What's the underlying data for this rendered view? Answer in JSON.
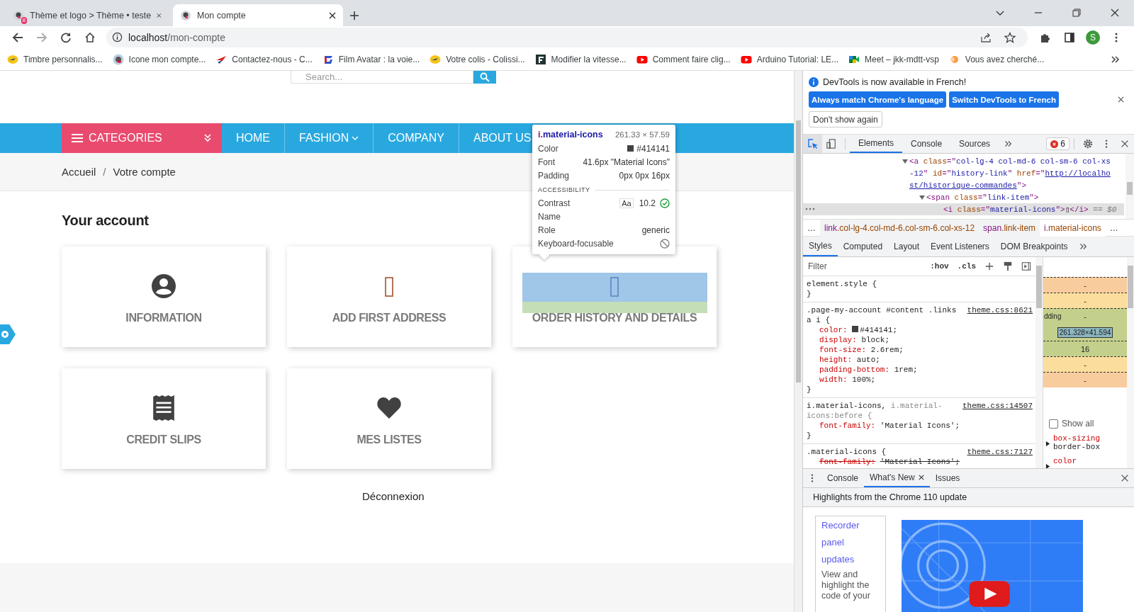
{
  "browser": {
    "tabs": [
      {
        "title": "Thème et logo > Thème • teste",
        "selected": false,
        "badge": "8"
      },
      {
        "title": "Mon compte",
        "selected": true
      }
    ],
    "address": {
      "host": "localhost",
      "path": "/mon-compte"
    },
    "profile_initial": "S",
    "bookmarks": [
      {
        "label": "Timbre personnalis...",
        "kind": "post"
      },
      {
        "label": "Icone mon compte...",
        "kind": "shop"
      },
      {
        "label": "Contactez-nous - C...",
        "kind": "plane"
      },
      {
        "label": "Film Avatar : la voie...",
        "kind": "g"
      },
      {
        "label": "Votre colis - Colissi...",
        "kind": "post"
      },
      {
        "label": "Modifier la vitesse...",
        "kind": "f"
      },
      {
        "label": "Comment faire clig...",
        "kind": "youtube"
      },
      {
        "label": "Arduino Tutorial: LE...",
        "kind": "youtube"
      },
      {
        "label": "Meet – jkk-mdtt-vsp",
        "kind": "meet"
      },
      {
        "label": "Vous avez cherché...",
        "kind": "dot"
      }
    ]
  },
  "page": {
    "search_placeholder": "Search...",
    "categories": "CATEGORIES",
    "nav": [
      {
        "label": "HOME",
        "dropdown": false
      },
      {
        "label": "FASHION",
        "dropdown": true
      },
      {
        "label": "COMPANY",
        "dropdown": false
      },
      {
        "label": "ABOUT US",
        "dropdown": false
      }
    ],
    "breadcrumb": {
      "items": [
        "Accueil",
        "Votre compte"
      ],
      "separator": "/"
    },
    "heading": "Your account",
    "cards": [
      {
        "label": "INFORMATION",
        "kind": "person",
        "highlighted": false
      },
      {
        "label": "ADD FIRST ADDRESS",
        "kind": "missing",
        "highlighted": false
      },
      {
        "label": "ORDER HISTORY AND DETAILS",
        "kind": "missing",
        "highlighted": true
      },
      {
        "label": "CREDIT SLIPS",
        "kind": "receipt",
        "highlighted": false
      },
      {
        "label": "MES LISTES",
        "kind": "heart",
        "highlighted": false
      }
    ],
    "logout": "Déconnexion"
  },
  "inspector_tooltip": {
    "selector": "i.material-icons",
    "size": "261.33 × 57.59",
    "rows": [
      {
        "label": "Color",
        "kind": "color",
        "value": "#414141"
      },
      {
        "label": "Font",
        "kind": "text",
        "value": "41.6px \"Material Icons\""
      },
      {
        "label": "Padding",
        "kind": "text",
        "value": "0px 0px 16px"
      }
    ],
    "accessibility": {
      "title": "ACCESSIBILITY",
      "rows": [
        {
          "label": "Contrast",
          "kind": "contrast",
          "sample": "Aa",
          "value": "10.2",
          "passes": true
        },
        {
          "label": "Name",
          "kind": "text"
        },
        {
          "label": "Role",
          "kind": "text",
          "value": "generic"
        },
        {
          "label": "Keyboard-focusable",
          "kind": "focusable",
          "focusable": false
        }
      ]
    }
  },
  "devtools": {
    "notice": {
      "text": "DevTools is now available in French!",
      "buttons": [
        "Always match Chrome's language",
        "Switch DevTools to French"
      ],
      "dismiss": "Don't show again"
    },
    "tabs": [
      {
        "label": "Elements",
        "selected": true
      },
      {
        "label": "Console",
        "selected": false
      },
      {
        "label": "Sources",
        "selected": false
      }
    ],
    "error_count": "6",
    "dom": {
      "expanded": true,
      "selected": false,
      "lines": [
        [
          {
            "text": "<a ",
            "kind": "tag"
          },
          {
            "text": "class",
            "kind": "attr"
          },
          {
            "text": "=\"",
            "kind": "tag"
          },
          {
            "text": "col-lg-4 col-md-6 col-sm-6 col-xs",
            "kind": "val"
          }
        ],
        [
          {
            "text": "-12",
            "kind": "val"
          },
          {
            "text": "\" ",
            "kind": "tag"
          },
          {
            "text": "id",
            "kind": "attr"
          },
          {
            "text": "=\"",
            "kind": "tag"
          },
          {
            "text": "history-link",
            "kind": "val"
          },
          {
            "text": "\" ",
            "kind": "tag"
          },
          {
            "text": "href",
            "kind": "attr"
          },
          {
            "text": "=\"",
            "kind": "tag"
          },
          {
            "text": "http://localho",
            "kind": "link"
          }
        ],
        [
          {
            "text": "st/historique-commandes",
            "kind": "link"
          },
          {
            "text": "\">",
            "kind": "tag"
          }
        ]
      ],
      "children": [
        {
          "expanded": true,
          "selected": false,
          "lines": [
            [
              {
                "text": "<span ",
                "kind": "tag"
              },
              {
                "text": "class",
                "kind": "attr"
              },
              {
                "text": "=\"",
                "kind": "tag"
              },
              {
                "text": "link-item",
                "kind": "val"
              },
              {
                "text": "\">",
                "kind": "tag"
              }
            ]
          ],
          "children": [
            {
              "selected": true,
              "lines": [
                [
                  {
                    "text": "<i ",
                    "kind": "tag"
                  },
                  {
                    "text": "class",
                    "kind": "attr"
                  },
                  {
                    "text": "=\"",
                    "kind": "tag"
                  },
                  {
                    "text": "material-icons",
                    "kind": "val"
                  },
                  {
                    "text": "\">",
                    "kind": "tag"
                  },
                  {
                    "text": "▯",
                    "kind": "text"
                  },
                  {
                    "text": "</i>",
                    "kind": "tag"
                  },
                  {
                    "text": " == $0",
                    "kind": "dim"
                  }
                ]
              ]
            }
          ]
        }
      ]
    },
    "crumbs": {
      "lead": "…",
      "trail": "…",
      "items": [
        {
          "tag": "link",
          "classes": ".col-lg-4.col-md-6.col-sm-6.col-xs-12",
          "selected": false
        },
        {
          "tag": "span",
          "classes": ".link-item",
          "selected": false
        },
        {
          "tag": "i",
          "classes": ".material-icons",
          "selected": true
        }
      ]
    },
    "pane_tabs": [
      {
        "label": "Styles",
        "selected": true
      },
      {
        "label": "Computed",
        "selected": false
      },
      {
        "label": "Layout",
        "selected": false
      },
      {
        "label": "Event Listeners",
        "selected": false
      },
      {
        "label": "DOM Breakpoints",
        "selected": false
      }
    ],
    "filter": {
      "placeholder": "Filter",
      "hov": ":hov",
      "cls": ".cls"
    },
    "rules": [
      {
        "selector": "element.style {",
        "close": "}"
      },
      {
        "selector": ".page-my-account #content .links a i {",
        "source": "theme.css:8621",
        "close": "}",
        "props": [
          {
            "name": "color:",
            "value": "#414141;",
            "swatch": true,
            "struck": false
          },
          {
            "name": "display:",
            "value": "block;",
            "swatch": false,
            "struck": false
          },
          {
            "name": "font-size:",
            "value": "2.6rem;",
            "swatch": false,
            "struck": false
          },
          {
            "name": "height:",
            "value": "auto;",
            "swatch": false,
            "struck": false
          },
          {
            "name": "padding-bottom:",
            "value": "1rem;",
            "swatch": false,
            "struck": false
          },
          {
            "name": "width:",
            "value": "100%;",
            "swatch": false,
            "struck": false
          }
        ]
      },
      {
        "selector": "i.material-icons,",
        "selector_dim": "i.material-icons:before {",
        "source": "theme.css:14507",
        "close": "}",
        "props": [
          {
            "name": "font-family:",
            "value": "'Material Icons';",
            "swatch": false,
            "struck": false
          }
        ]
      },
      {
        "selector": ".material-icons {",
        "source": "theme.css:7127",
        "props": [
          {
            "name": "font-family:",
            "value": "'Material Icons';",
            "swatch": false,
            "struck": true
          }
        ]
      }
    ],
    "box_model": [
      {
        "kind": "margin",
        "value": "-"
      },
      {
        "kind": "border",
        "value": "-"
      },
      {
        "kind": "padding",
        "value": "-",
        "label": "dding"
      },
      {
        "kind": "content",
        "value": "261.328×41.594"
      },
      {
        "kind": "padding",
        "value": "16"
      },
      {
        "kind": "border",
        "value": "-"
      },
      {
        "kind": "margin",
        "value": "-"
      }
    ],
    "show_all": {
      "label": "Show all",
      "checked": false
    },
    "computed": [
      {
        "name": "box-sizing",
        "value": "border-box"
      },
      {
        "name": "color"
      }
    ],
    "drawer": {
      "tabs": [
        {
          "label": "Console",
          "selected": false,
          "closable": false
        },
        {
          "label": "What's New",
          "selected": true,
          "closable": true
        },
        {
          "label": "Issues",
          "selected": false,
          "closable": false
        }
      ],
      "header": "Highlights from the Chrome 110 update",
      "links": [
        "Recorder",
        "panel",
        "updates"
      ],
      "text": "View and highlight the code of your"
    }
  }
}
